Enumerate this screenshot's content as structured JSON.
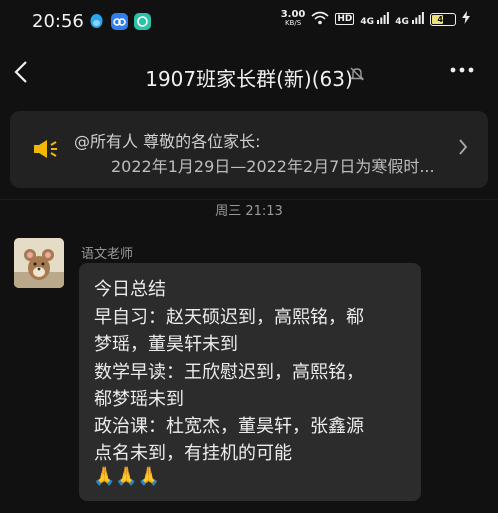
{
  "status_bar": {
    "time": "20:56",
    "net_speed_value": "3.00",
    "net_speed_unit": "KB/S",
    "hd_label": "HD",
    "signal1": "4G",
    "signal2": "4G",
    "battery": "48"
  },
  "nav": {
    "title": "1907班家长群(新)(63)"
  },
  "notice": {
    "line1": "@所有人 尊敬的各位家长:",
    "line2": "2022年1月29日—2022年2月7日为寒假时..."
  },
  "chat": {
    "timestamp": "周三 21:13",
    "messages": [
      {
        "sender": "语文老师",
        "lines": [
          "今日总结",
          "早自习：赵天硕迟到，高熙铭，郗",
          "梦瑶，董昊轩未到",
          "数学早读：王欣慰迟到，高熙铭，",
          "郗梦瑶未到",
          "政治课：杜宽杰，董昊轩，张鑫源",
          "点名未到，有挂机的可能"
        ],
        "emoji": "🙏🙏🙏"
      }
    ]
  }
}
